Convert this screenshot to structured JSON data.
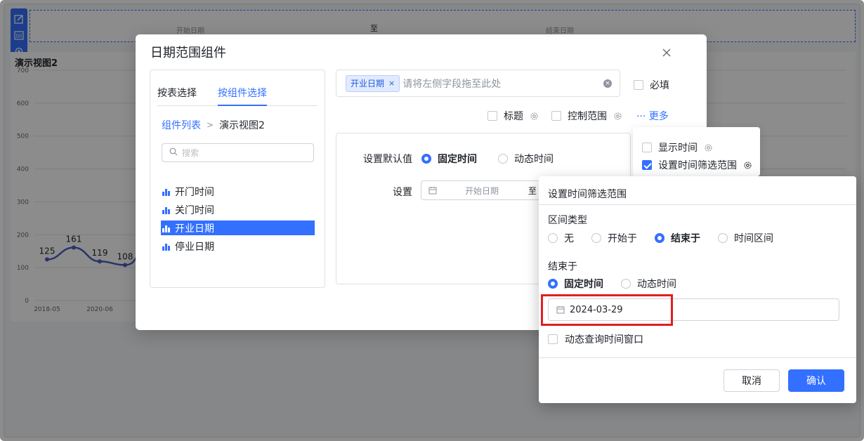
{
  "background": {
    "filter_start": "开始日期",
    "filter_to": "至",
    "filter_end": "结束日期",
    "chart_title": "演示视图2"
  },
  "chart_data": {
    "type": "line",
    "title": "演示视图2",
    "y_ticks": [
      "700",
      "600",
      "500",
      "400",
      "300",
      "200",
      "100",
      "0"
    ],
    "ylim": [
      0,
      700
    ],
    "x_ticks": [
      "2018-05",
      "2020-06"
    ],
    "points": [
      {
        "x": "2018-05",
        "y": 125,
        "label": "125"
      },
      {
        "x": "",
        "y": 161,
        "label": "161"
      },
      {
        "x": "2020-06",
        "y": 119,
        "label": "119"
      },
      {
        "x": "",
        "y": 108,
        "label": "108"
      }
    ],
    "grid": true
  },
  "dialog": {
    "title": "日期范围组件",
    "tabs": [
      "按表选择",
      "按组件选择"
    ],
    "active_tab": 1,
    "breadcrumb": {
      "link": "组件列表",
      "current": "演示视图2"
    },
    "search_placeholder": "搜索",
    "fields": [
      "开门时间",
      "关门时间",
      "开业日期",
      "停业日期"
    ],
    "selected_field": "开业日期",
    "field_box": {
      "tag": "开业日期",
      "placeholder": "请将左侧字段拖至此处"
    },
    "required_label": "必填",
    "opt_title": "标题",
    "opt_control_range": "控制范围",
    "more_label": "··· 更多",
    "default_label": "设置默认值",
    "default_fixed": "固定时间",
    "default_dynamic": "动态时间",
    "set_label": "设置",
    "range_start_placeholder": "开始日期",
    "range_to": "至"
  },
  "dropdown": {
    "show_time": "显示时间",
    "set_range": "设置时间筛选范围"
  },
  "popup": {
    "title": "设置时间筛选范围",
    "interval_type_label": "区间类型",
    "interval_options": [
      "无",
      "开始于",
      "结束于",
      "时间区间"
    ],
    "interval_selected": "结束于",
    "end_at_label": "结束于",
    "end_fixed": "固定时间",
    "end_dynamic": "动态时间",
    "date_value": "2024-03-29",
    "dynamic_window_label": "动态查询时间窗口",
    "cancel": "取消",
    "confirm": "确认"
  }
}
